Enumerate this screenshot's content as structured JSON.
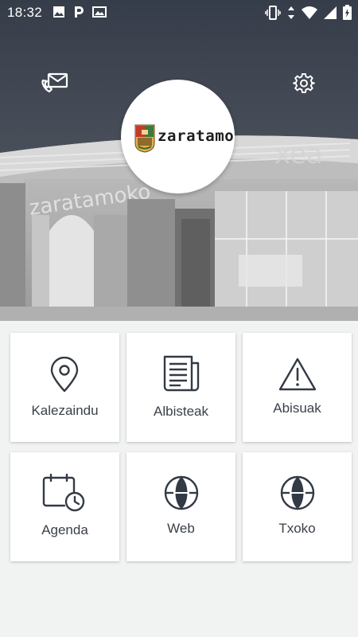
{
  "status_bar": {
    "time": "18:32",
    "left_icons": [
      "image-icon",
      "parking-icon",
      "photo-gallery-icon"
    ],
    "right_icons": [
      "vibrate-icon",
      "data-arrows-icon",
      "wifi-icon",
      "signal-icon",
      "battery-charging-icon"
    ]
  },
  "header": {
    "logo_text": "zaratamo",
    "contact_icon": "envelope-phone-icon",
    "settings_icon": "gear-icon"
  },
  "tiles": [
    {
      "label": "Kalezaindu",
      "icon": "location-pin-icon"
    },
    {
      "label": "Albisteak",
      "icon": "newspaper-icon"
    },
    {
      "label": "Abisuak",
      "icon": "warning-icon"
    },
    {
      "label": "Agenda",
      "icon": "calendar-clock-icon"
    },
    {
      "label": "Web",
      "icon": "globe-icon"
    },
    {
      "label": "Txoko",
      "icon": "globe-icon"
    }
  ],
  "colors": {
    "header_dark": "#363d4a",
    "icon_stroke": "#333a45",
    "background": "#f1f2f2",
    "tile": "#ffffff"
  }
}
